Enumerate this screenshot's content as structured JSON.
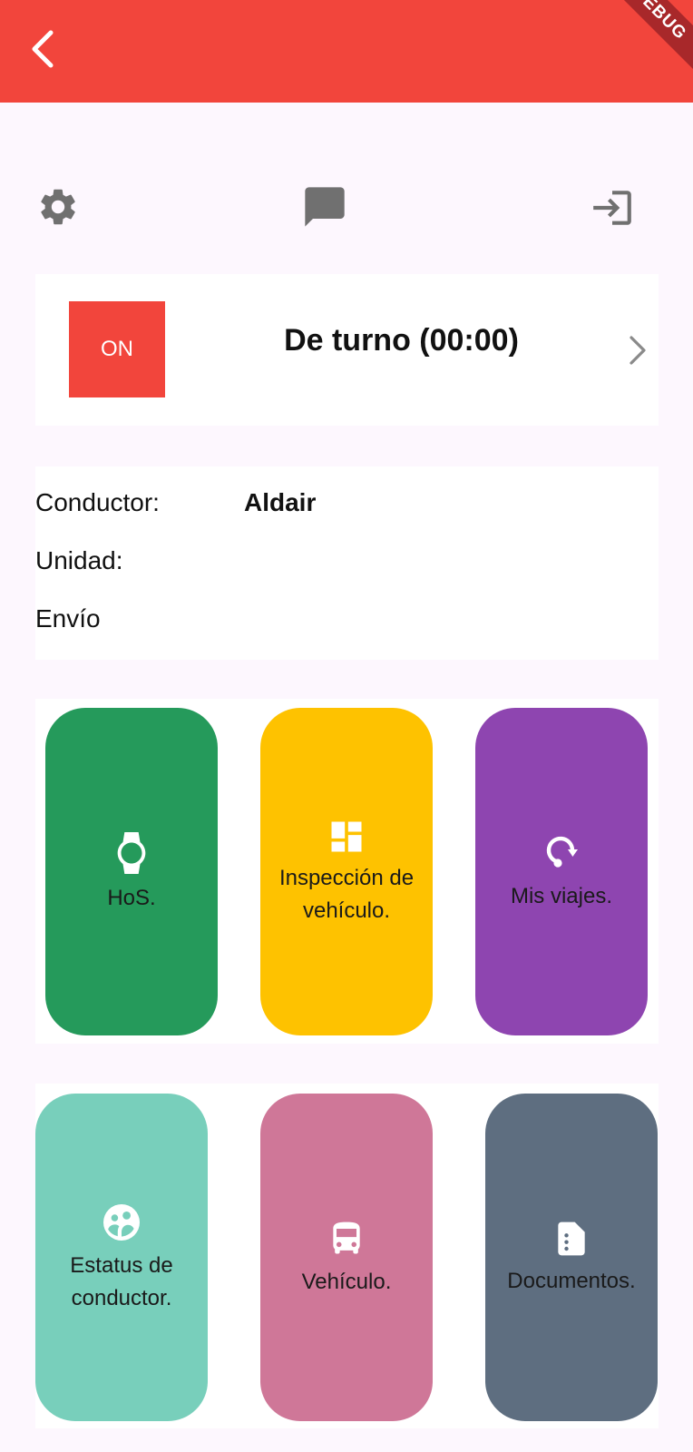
{
  "appbar": {
    "back_icon": "arrow-back-icon",
    "debug_label": "DEBUG",
    "color": "#f2453c"
  },
  "toolbar": {
    "settings_icon": "gear-icon",
    "chat_icon": "chat-icon",
    "logout_icon": "login-icon"
  },
  "shift": {
    "badge": "ON",
    "title": "De turno (00:00)",
    "chevron_icon": "chevron-right-icon"
  },
  "info": {
    "driver_label": "Conductor:",
    "driver_value": "Aldair",
    "unit_label": "Unidad:",
    "unit_value": "",
    "shipment_label": "Envío",
    "shipment_value": ""
  },
  "tiles_row1": [
    {
      "label": "HoS.",
      "icon": "watch-icon",
      "color": "#259a5b"
    },
    {
      "label": "Inspección de vehículo.",
      "icon": "dashboard-icon",
      "color": "#fec200"
    },
    {
      "label": "Mis viajes.",
      "icon": "trip-icon",
      "color": "#8e45b0"
    }
  ],
  "tiles_row2": [
    {
      "label": "Estatus de conductor.",
      "icon": "group-icon",
      "color": "#78cfbb"
    },
    {
      "label": "Vehículo.",
      "icon": "bus-icon",
      "color": "#cf7798"
    },
    {
      "label": "Documentos.",
      "icon": "document-icon",
      "color": "#5e6e80"
    }
  ]
}
